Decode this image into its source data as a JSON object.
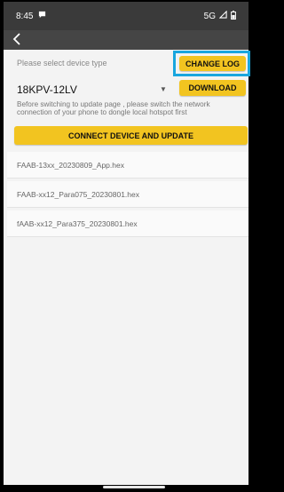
{
  "status": {
    "time": "8:45",
    "network": "5G"
  },
  "toolbar": {
    "back_icon": "chevron-left-icon"
  },
  "main": {
    "prompt": "Please select device type",
    "change_log_label": "CHANGE LOG",
    "device_type_selected": "18KPV-12LV",
    "download_label": "DOWNLOAD",
    "note": "Before switching to update page , please switch the network connection of your phone to dongle local hotspot first",
    "connect_label": "CONNECT DEVICE AND UPDATE",
    "files": [
      "FAAB-13xx_20230809_App.hex",
      "FAAB-xx12_Para075_20230801.hex",
      "fAAB-xx12_Para375_20230801.hex"
    ]
  },
  "colors": {
    "accent_yellow": "#f2c420",
    "highlight_blue": "#19a6de",
    "appbar": "#454545"
  }
}
